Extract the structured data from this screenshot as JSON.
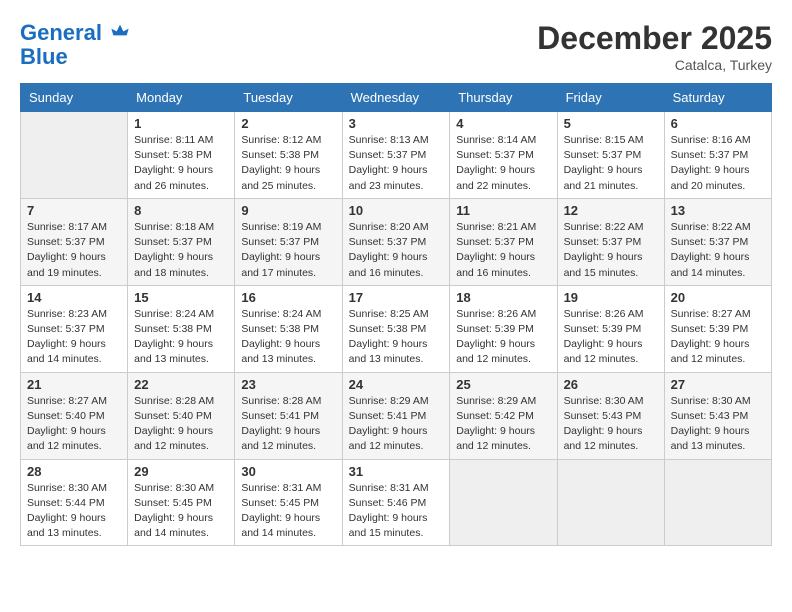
{
  "header": {
    "logo_line1": "General",
    "logo_line2": "Blue",
    "month": "December 2025",
    "location": "Catalca, Turkey"
  },
  "days_of_week": [
    "Sunday",
    "Monday",
    "Tuesday",
    "Wednesday",
    "Thursday",
    "Friday",
    "Saturday"
  ],
  "weeks": [
    [
      {
        "day": "",
        "info": ""
      },
      {
        "day": "1",
        "info": "Sunrise: 8:11 AM\nSunset: 5:38 PM\nDaylight: 9 hours\nand 26 minutes."
      },
      {
        "day": "2",
        "info": "Sunrise: 8:12 AM\nSunset: 5:38 PM\nDaylight: 9 hours\nand 25 minutes."
      },
      {
        "day": "3",
        "info": "Sunrise: 8:13 AM\nSunset: 5:37 PM\nDaylight: 9 hours\nand 23 minutes."
      },
      {
        "day": "4",
        "info": "Sunrise: 8:14 AM\nSunset: 5:37 PM\nDaylight: 9 hours\nand 22 minutes."
      },
      {
        "day": "5",
        "info": "Sunrise: 8:15 AM\nSunset: 5:37 PM\nDaylight: 9 hours\nand 21 minutes."
      },
      {
        "day": "6",
        "info": "Sunrise: 8:16 AM\nSunset: 5:37 PM\nDaylight: 9 hours\nand 20 minutes."
      }
    ],
    [
      {
        "day": "7",
        "info": "Sunrise: 8:17 AM\nSunset: 5:37 PM\nDaylight: 9 hours\nand 19 minutes."
      },
      {
        "day": "8",
        "info": "Sunrise: 8:18 AM\nSunset: 5:37 PM\nDaylight: 9 hours\nand 18 minutes."
      },
      {
        "day": "9",
        "info": "Sunrise: 8:19 AM\nSunset: 5:37 PM\nDaylight: 9 hours\nand 17 minutes."
      },
      {
        "day": "10",
        "info": "Sunrise: 8:20 AM\nSunset: 5:37 PM\nDaylight: 9 hours\nand 16 minutes."
      },
      {
        "day": "11",
        "info": "Sunrise: 8:21 AM\nSunset: 5:37 PM\nDaylight: 9 hours\nand 16 minutes."
      },
      {
        "day": "12",
        "info": "Sunrise: 8:22 AM\nSunset: 5:37 PM\nDaylight: 9 hours\nand 15 minutes."
      },
      {
        "day": "13",
        "info": "Sunrise: 8:22 AM\nSunset: 5:37 PM\nDaylight: 9 hours\nand 14 minutes."
      }
    ],
    [
      {
        "day": "14",
        "info": "Sunrise: 8:23 AM\nSunset: 5:37 PM\nDaylight: 9 hours\nand 14 minutes."
      },
      {
        "day": "15",
        "info": "Sunrise: 8:24 AM\nSunset: 5:38 PM\nDaylight: 9 hours\nand 13 minutes."
      },
      {
        "day": "16",
        "info": "Sunrise: 8:24 AM\nSunset: 5:38 PM\nDaylight: 9 hours\nand 13 minutes."
      },
      {
        "day": "17",
        "info": "Sunrise: 8:25 AM\nSunset: 5:38 PM\nDaylight: 9 hours\nand 13 minutes."
      },
      {
        "day": "18",
        "info": "Sunrise: 8:26 AM\nSunset: 5:39 PM\nDaylight: 9 hours\nand 12 minutes."
      },
      {
        "day": "19",
        "info": "Sunrise: 8:26 AM\nSunset: 5:39 PM\nDaylight: 9 hours\nand 12 minutes."
      },
      {
        "day": "20",
        "info": "Sunrise: 8:27 AM\nSunset: 5:39 PM\nDaylight: 9 hours\nand 12 minutes."
      }
    ],
    [
      {
        "day": "21",
        "info": "Sunrise: 8:27 AM\nSunset: 5:40 PM\nDaylight: 9 hours\nand 12 minutes."
      },
      {
        "day": "22",
        "info": "Sunrise: 8:28 AM\nSunset: 5:40 PM\nDaylight: 9 hours\nand 12 minutes."
      },
      {
        "day": "23",
        "info": "Sunrise: 8:28 AM\nSunset: 5:41 PM\nDaylight: 9 hours\nand 12 minutes."
      },
      {
        "day": "24",
        "info": "Sunrise: 8:29 AM\nSunset: 5:41 PM\nDaylight: 9 hours\nand 12 minutes."
      },
      {
        "day": "25",
        "info": "Sunrise: 8:29 AM\nSunset: 5:42 PM\nDaylight: 9 hours\nand 12 minutes."
      },
      {
        "day": "26",
        "info": "Sunrise: 8:30 AM\nSunset: 5:43 PM\nDaylight: 9 hours\nand 12 minutes."
      },
      {
        "day": "27",
        "info": "Sunrise: 8:30 AM\nSunset: 5:43 PM\nDaylight: 9 hours\nand 13 minutes."
      }
    ],
    [
      {
        "day": "28",
        "info": "Sunrise: 8:30 AM\nSunset: 5:44 PM\nDaylight: 9 hours\nand 13 minutes."
      },
      {
        "day": "29",
        "info": "Sunrise: 8:30 AM\nSunset: 5:45 PM\nDaylight: 9 hours\nand 14 minutes."
      },
      {
        "day": "30",
        "info": "Sunrise: 8:31 AM\nSunset: 5:45 PM\nDaylight: 9 hours\nand 14 minutes."
      },
      {
        "day": "31",
        "info": "Sunrise: 8:31 AM\nSunset: 5:46 PM\nDaylight: 9 hours\nand 15 minutes."
      },
      {
        "day": "",
        "info": ""
      },
      {
        "day": "",
        "info": ""
      },
      {
        "day": "",
        "info": ""
      }
    ]
  ]
}
